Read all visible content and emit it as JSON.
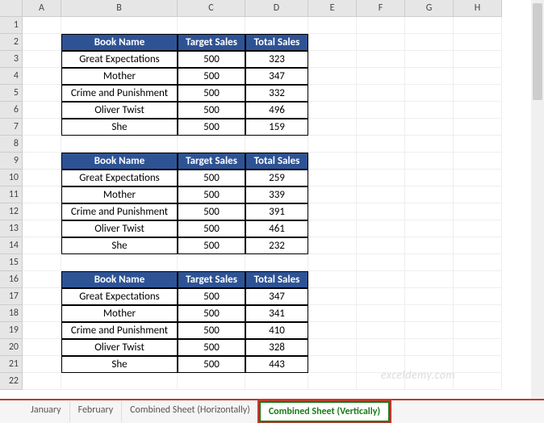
{
  "columns": [
    "A",
    "B",
    "C",
    "D",
    "E",
    "F",
    "G",
    "H"
  ],
  "rows_visible": 22,
  "tables": [
    {
      "header": {
        "book": "Book Name",
        "target": "Target Sales",
        "total": "Total Sales"
      },
      "rows": [
        {
          "book": "Great Expectations",
          "target": 500,
          "total": 323
        },
        {
          "book": "Mother",
          "target": 500,
          "total": 347
        },
        {
          "book": "Crime and Punishment",
          "target": 500,
          "total": 332
        },
        {
          "book": "Oliver Twist",
          "target": 500,
          "total": 496
        },
        {
          "book": "She",
          "target": 500,
          "total": 159
        }
      ]
    },
    {
      "header": {
        "book": "Book Name",
        "target": "Target Sales",
        "total": "Total Sales"
      },
      "rows": [
        {
          "book": "Great Expectations",
          "target": 500,
          "total": 259
        },
        {
          "book": "Mother",
          "target": 500,
          "total": 339
        },
        {
          "book": "Crime and Punishment",
          "target": 500,
          "total": 391
        },
        {
          "book": "Oliver Twist",
          "target": 500,
          "total": 461
        },
        {
          "book": "She",
          "target": 500,
          "total": 232
        }
      ]
    },
    {
      "header": {
        "book": "Book Name",
        "target": "Target Sales",
        "total": "Total Sales"
      },
      "rows": [
        {
          "book": "Great Expectations",
          "target": 500,
          "total": 347
        },
        {
          "book": "Mother",
          "target": 500,
          "total": 341
        },
        {
          "book": "Crime and Punishment",
          "target": 500,
          "total": 410
        },
        {
          "book": "Oliver Twist",
          "target": 500,
          "total": 328
        },
        {
          "book": "She",
          "target": 500,
          "total": 443
        }
      ]
    }
  ],
  "tabs": {
    "items": [
      "January",
      "February",
      "Combined Sheet (Horizontally)",
      "Combined Sheet (Vertically)"
    ],
    "active_index": 3
  },
  "watermark": "exceldemy.com"
}
